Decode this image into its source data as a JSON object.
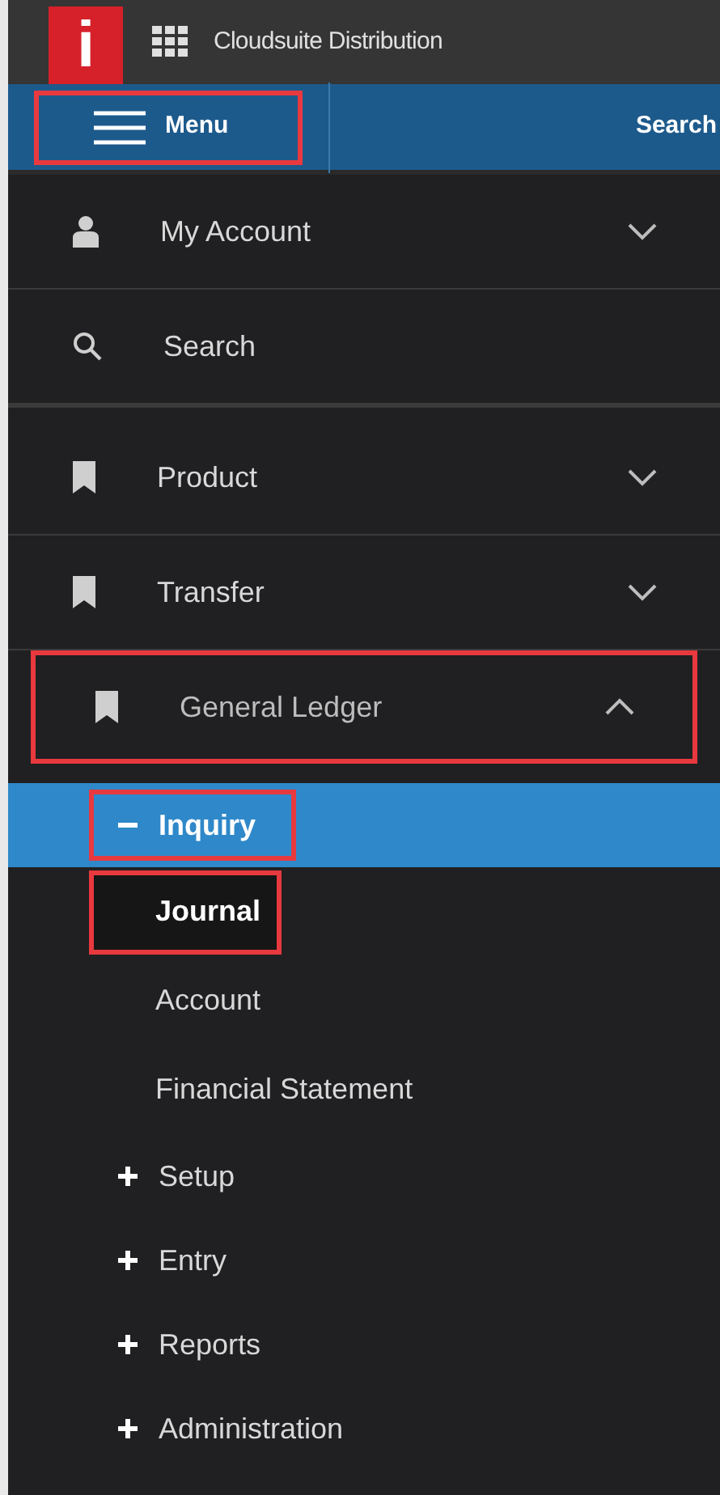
{
  "header": {
    "logo": "i",
    "title": "Cloudsuite Distribution"
  },
  "toolbar": {
    "menu_button": {
      "label": "Menu",
      "highlighted": true
    },
    "search_label": "Search"
  },
  "nav": [
    {
      "kind": "account",
      "label": "My Account",
      "expanded": false,
      "highlighted": false
    },
    {
      "kind": "search",
      "label": "Search",
      "highlighted": false
    },
    {
      "kind": "module",
      "label": "Product",
      "expanded": false,
      "highlighted": false
    },
    {
      "kind": "module",
      "label": "Transfer",
      "expanded": false,
      "highlighted": false
    },
    {
      "kind": "module",
      "label": "General Ledger",
      "expanded": true,
      "highlighted": true,
      "children": [
        {
          "label": "Inquiry",
          "expanded": true,
          "selected": true,
          "highlighted": true,
          "children": [
            {
              "label": "Journal",
              "highlighted": true
            },
            {
              "label": "Account",
              "highlighted": false
            },
            {
              "label": "Financial Statement",
              "highlighted": false
            }
          ]
        },
        {
          "label": "Setup",
          "expanded": false,
          "selected": false,
          "highlighted": false
        },
        {
          "label": "Entry",
          "expanded": false,
          "selected": false,
          "highlighted": false
        },
        {
          "label": "Reports",
          "expanded": false,
          "selected": false,
          "highlighted": false
        },
        {
          "label": "Administration",
          "expanded": false,
          "selected": false,
          "highlighted": false
        }
      ]
    }
  ]
}
